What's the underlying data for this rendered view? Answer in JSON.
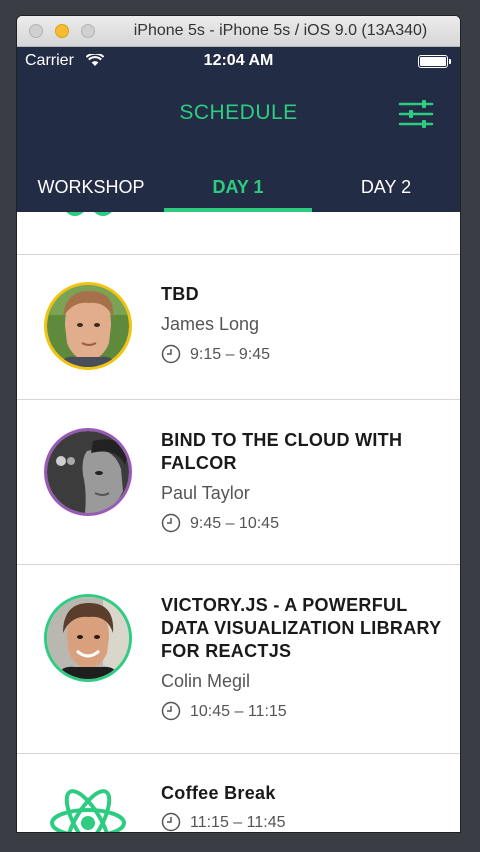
{
  "window": {
    "title": "iPhone 5s - iPhone 5s / iOS 9.0 (13A340)"
  },
  "status_bar": {
    "carrier": "Carrier",
    "time": "12:04 AM"
  },
  "header": {
    "title": "SCHEDULE",
    "tabs": [
      {
        "label": "WORKSHOP"
      },
      {
        "label": "DAY 1"
      },
      {
        "label": "DAY 2"
      }
    ],
    "active_tab": "DAY 1"
  },
  "sessions": [
    {
      "title": "TBD",
      "speaker": "James Long",
      "time": "9:15 – 9:45",
      "ring_color": "#f1c40f"
    },
    {
      "title": "BIND TO THE CLOUD WITH FALCOR",
      "speaker": "Paul Taylor",
      "time": "9:45 – 10:45",
      "ring_color": "#9b59b6"
    },
    {
      "title": "VICTORY.JS - A POWERFUL DATA VISUALIZATION LIBRARY FOR REACTJS",
      "speaker": "Colin Megil",
      "time": "10:45 – 11:15",
      "ring_color": "#2ecc80"
    },
    {
      "title": "Coffee Break",
      "time": "11:15 – 11:45",
      "icon": "react-atom-icon"
    }
  ],
  "colors": {
    "accent": "#2ecc80",
    "navy": "#232c45"
  }
}
